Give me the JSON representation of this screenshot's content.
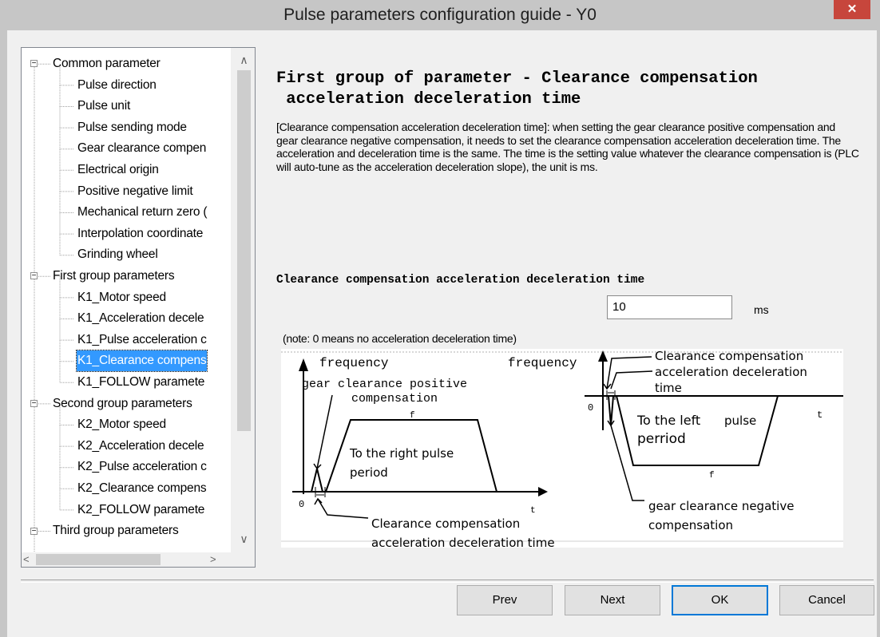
{
  "window": {
    "title": "Pulse parameters configuration guide - Y0",
    "close_glyph": "✕"
  },
  "tree": {
    "rows": [
      {
        "label": "Common parameter",
        "expander": "−"
      },
      {
        "label": "Pulse direction"
      },
      {
        "label": "Pulse unit"
      },
      {
        "label": "Pulse sending mode"
      },
      {
        "label": "Gear clearance compen"
      },
      {
        "label": "Electrical origin"
      },
      {
        "label": "Positive negative limit"
      },
      {
        "label": "Mechanical return zero ("
      },
      {
        "label": "Interpolation coordinate"
      },
      {
        "label": "Grinding wheel"
      },
      {
        "label": "First group parameters",
        "expander": "−"
      },
      {
        "label": "K1_Motor speed"
      },
      {
        "label": "K1_Acceleration decele"
      },
      {
        "label": "K1_Pulse acceleration c"
      },
      {
        "label": "K1_Clearance compens",
        "selected": true
      },
      {
        "label": "K1_FOLLOW paramete"
      },
      {
        "label": "Second group parameters",
        "expander": "−"
      },
      {
        "label": "K2_Motor speed"
      },
      {
        "label": "K2_Acceleration decele"
      },
      {
        "label": "K2_Pulse acceleration c"
      },
      {
        "label": "K2_Clearance compens"
      },
      {
        "label": "K2_FOLLOW paramete"
      },
      {
        "label": "Third group parameters",
        "expander": "−"
      }
    ],
    "scroll_up": "∧",
    "scroll_down": "∨",
    "scroll_left": "<",
    "scroll_right": ">"
  },
  "content": {
    "heading": "First group of parameter - Clearance compensation\n acceleration deceleration time",
    "description": "[Clearance compensation acceleration deceleration time]: when setting the gear clearance positive compensation and gear clearance negative compensation, it needs to set the clearance compensation acceleration deceleration time. The acceleration and deceleration time is the same. The time is the setting value whatever the clearance compensation is (PLC will auto-tune as the acceleration deceleration slope), the unit is ms.",
    "field_label": "Clearance compensation acceleration deceleration time",
    "field_value": "10",
    "unit": "ms",
    "note": "(note: 0 means no acceleration deceleration time)"
  },
  "diagram": {
    "left": {
      "y_axis": "frequency",
      "pos_label": "gear clearance positive",
      "pos_label2": "compensation",
      "f_mark": "f",
      "t_mark": "t",
      "origin": "0",
      "period1": "To the right pulse",
      "period2": "period",
      "bottom1": "Clearance compensation",
      "bottom2": "acceleration deceleration time"
    },
    "right": {
      "y_axis": "frequency",
      "top1": "Clearance compensation",
      "top2": "acceleration deceleration",
      "top3": "time",
      "origin": "0",
      "t_mark": "t",
      "f_mark": "f",
      "period1a": "To the left",
      "period1b": "pulse",
      "period2": "perriod",
      "neg1": "gear clearance negative",
      "neg2": "compensation"
    }
  },
  "buttons": {
    "prev": "Prev",
    "next": "Next",
    "ok": "OK",
    "cancel": "Cancel"
  },
  "colors": {
    "selection": "#3399ff",
    "close": "#c7463c",
    "titlebar": "#c6c6c6",
    "default_button_border": "#0078d7"
  }
}
